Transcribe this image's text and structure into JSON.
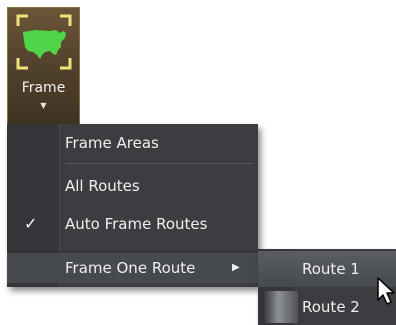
{
  "ribbon": {
    "frame_button": {
      "label": "Frame",
      "icon": "usa-map-frame-icon",
      "dropdown_icon": "dropdown-arrow-icon"
    }
  },
  "menu": {
    "items": [
      {
        "label": "Frame Areas",
        "checked": false,
        "has_submenu": false
      },
      {
        "label": "All Routes",
        "checked": false,
        "has_submenu": false
      },
      {
        "label": "Auto Frame Routes",
        "checked": true,
        "has_submenu": false
      },
      {
        "label": "Frame One Route",
        "checked": false,
        "has_submenu": true
      }
    ]
  },
  "submenu": {
    "items": [
      {
        "label": "Route 1",
        "highlighted": true
      },
      {
        "label": "Route 2",
        "highlighted": false
      }
    ]
  },
  "colors": {
    "map_green": "#4fd44a",
    "frame_corners": "#f2e27a",
    "menu_bg": "#3b3d40",
    "button_bg": "#5a4830"
  }
}
